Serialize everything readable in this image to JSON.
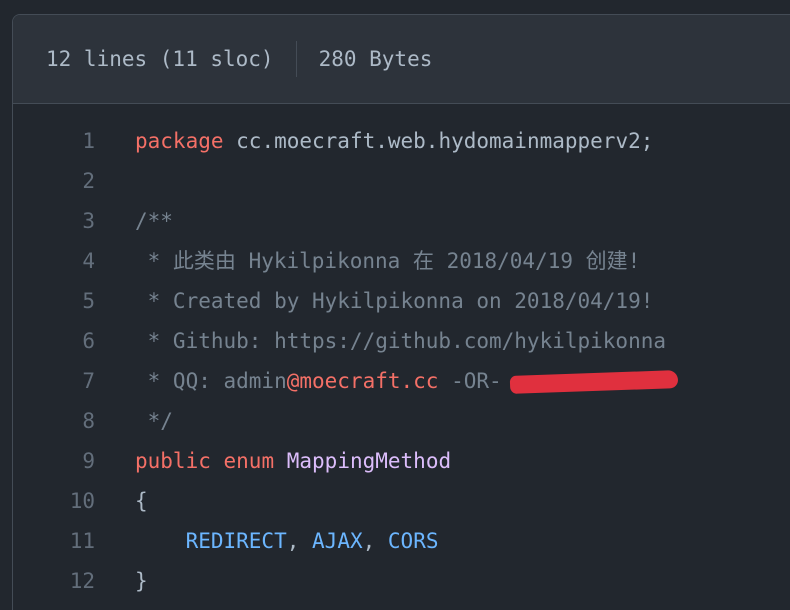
{
  "file_info": {
    "lines": "12 lines (11 sloc)",
    "size": "280 Bytes"
  },
  "code": {
    "lines": [
      {
        "num": "1",
        "tokens": [
          {
            "t": "kw",
            "v": "package"
          },
          {
            "t": "plain",
            "v": " cc.moecraft.web.hydomainmapperv2;"
          }
        ]
      },
      {
        "num": "2",
        "tokens": []
      },
      {
        "num": "3",
        "tokens": [
          {
            "t": "cm",
            "v": "/**"
          }
        ]
      },
      {
        "num": "4",
        "tokens": [
          {
            "t": "cm",
            "v": " * 此类由 Hykilpikonna 在 2018/04/19 创建!"
          }
        ]
      },
      {
        "num": "5",
        "tokens": [
          {
            "t": "cm",
            "v": " * Created by Hykilpikonna on 2018/04/19!"
          }
        ]
      },
      {
        "num": "6",
        "tokens": [
          {
            "t": "cm",
            "v": " * Github: https://github.com/hykilpikonna"
          }
        ]
      },
      {
        "num": "7",
        "tokens": [
          {
            "t": "cm",
            "v": " * QQ: admin"
          },
          {
            "t": "email",
            "v": "@moecraft.cc"
          },
          {
            "t": "cm",
            "v": " -OR-"
          },
          {
            "t": "redact",
            "v": ""
          }
        ]
      },
      {
        "num": "8",
        "tokens": [
          {
            "t": "cm",
            "v": " */"
          }
        ]
      },
      {
        "num": "9",
        "tokens": [
          {
            "t": "kw",
            "v": "public"
          },
          {
            "t": "plain",
            "v": " "
          },
          {
            "t": "kw",
            "v": "enum"
          },
          {
            "t": "plain",
            "v": " "
          },
          {
            "t": "cls",
            "v": "MappingMethod"
          }
        ]
      },
      {
        "num": "10",
        "tokens": [
          {
            "t": "plain",
            "v": "{"
          }
        ]
      },
      {
        "num": "11",
        "tokens": [
          {
            "t": "plain",
            "v": "    "
          },
          {
            "t": "const",
            "v": "REDIRECT"
          },
          {
            "t": "plain",
            "v": ", "
          },
          {
            "t": "const",
            "v": "AJAX"
          },
          {
            "t": "plain",
            "v": ", "
          },
          {
            "t": "const",
            "v": "CORS"
          }
        ]
      },
      {
        "num": "12",
        "tokens": [
          {
            "t": "plain",
            "v": "}"
          }
        ]
      }
    ]
  },
  "colors": {
    "background": "#22272e",
    "header": "#2d333b",
    "keyword": "#f47067",
    "class_name": "#dcbdfb",
    "constant": "#6cb6ff",
    "comment": "#768390",
    "redaction": "#e0303e"
  }
}
